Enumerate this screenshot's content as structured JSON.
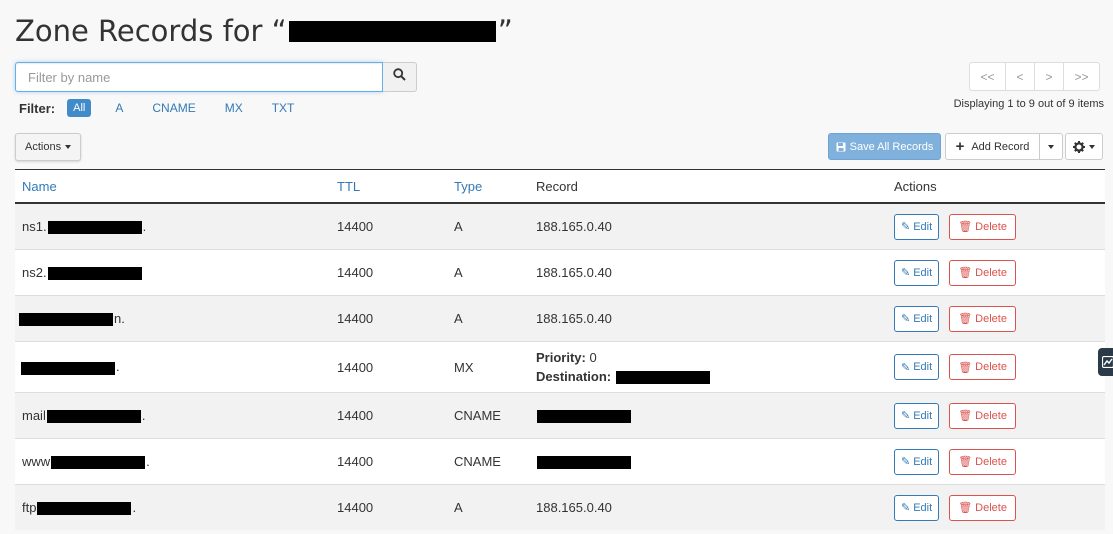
{
  "header": {
    "title_prefix": "Zone Records for “",
    "title_suffix": "”"
  },
  "search": {
    "placeholder": "Filter by name",
    "icon": "search-icon"
  },
  "filter": {
    "label": "Filter:",
    "options": [
      "All",
      "A",
      "CNAME",
      "MX",
      "TXT"
    ],
    "active": "All"
  },
  "pager": {
    "first": "<<",
    "prev": "<",
    "next": ">",
    "last": ">>",
    "displaying": "Displaying 1 to 9 out of 9 items"
  },
  "toolbar": {
    "actions_label": "Actions",
    "save_label": "Save All Records",
    "add_label": "Add Record",
    "colors": {
      "primary": "#428bca",
      "danger": "#d9534f"
    }
  },
  "table": {
    "headers": {
      "name": "Name",
      "ttl": "TTL",
      "type": "Type",
      "record": "Record",
      "actions": "Actions"
    },
    "edit_label": "Edit",
    "delete_label": "Delete",
    "mx_priority_label": "Priority:",
    "mx_destination_label": "Destination:",
    "rows": [
      {
        "name_prefix": "ns1.",
        "name_suffix": ".",
        "ttl": "14400",
        "type": "A",
        "record": "188.165.0.40"
      },
      {
        "name_prefix": "ns2.",
        "name_suffix": "",
        "ttl": "14400",
        "type": "A",
        "record": "188.165.0.40"
      },
      {
        "name_prefix": "",
        "name_suffix": "n.",
        "ttl": "14400",
        "type": "A",
        "record": "188.165.0.40"
      },
      {
        "name_prefix": "",
        "name_suffix": ".",
        "ttl": "14400",
        "type": "MX",
        "priority": "0"
      },
      {
        "name_prefix": "mail",
        "name_suffix": ".",
        "ttl": "14400",
        "type": "CNAME"
      },
      {
        "name_prefix": "www",
        "name_suffix": ".",
        "ttl": "14400",
        "type": "CNAME"
      },
      {
        "name_prefix": "ftp",
        "name_suffix": ".",
        "ttl": "14400",
        "type": "A",
        "record": "188.165.0.40"
      }
    ]
  }
}
